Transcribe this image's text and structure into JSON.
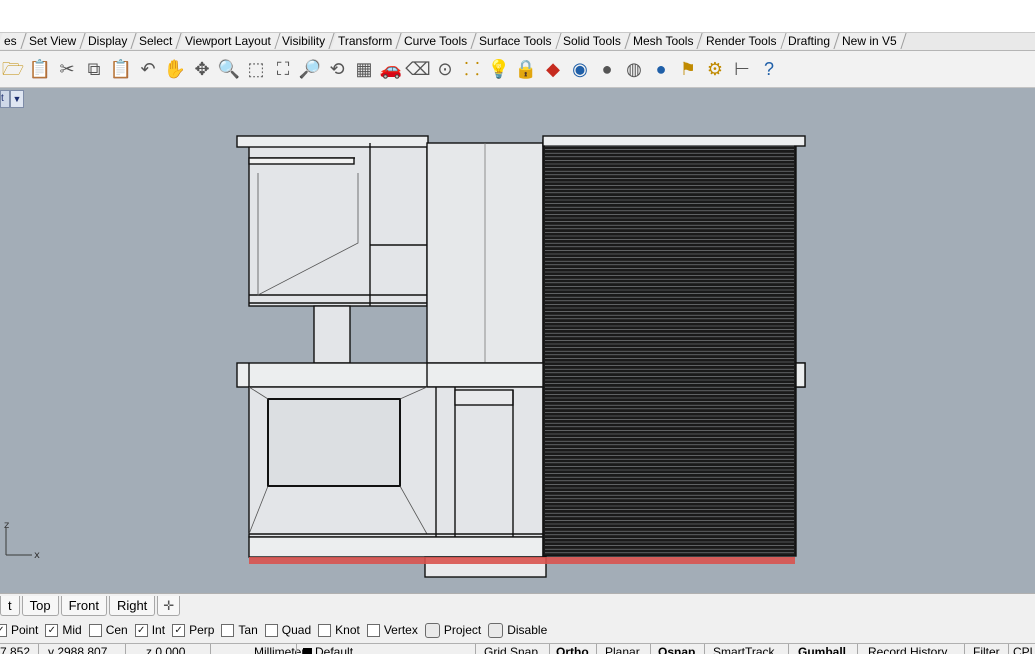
{
  "toolbar_tabs": [
    "es",
    "Set View",
    "Display",
    "Select",
    "Viewport Layout",
    "Visibility",
    "Transform",
    "Curve Tools",
    "Surface Tools",
    "Solid Tools",
    "Mesh Tools",
    "Render Tools",
    "Drafting",
    "New in V5"
  ],
  "toolbar_icons": [
    {
      "name": "open-icon",
      "glyph": "🗁",
      "cls": "c3"
    },
    {
      "name": "paste-icon",
      "glyph": "📋",
      "cls": "c5"
    },
    {
      "name": "cut-icon",
      "glyph": "✂",
      "cls": "c5"
    },
    {
      "name": "copy-icon",
      "glyph": "⧉",
      "cls": "c5"
    },
    {
      "name": "clipboard-icon",
      "glyph": "📋",
      "cls": "c3"
    },
    {
      "name": "undo-icon",
      "glyph": "↶",
      "cls": "c5"
    },
    {
      "name": "pan-hand-icon",
      "glyph": "✋",
      "cls": "c5"
    },
    {
      "name": "rotate-view-icon",
      "glyph": "✥",
      "cls": "c5"
    },
    {
      "name": "zoom-icon",
      "glyph": "🔍",
      "cls": "c5"
    },
    {
      "name": "zoom-window-icon",
      "glyph": "⬚",
      "cls": "c5"
    },
    {
      "name": "zoom-extents-icon",
      "glyph": "⛶",
      "cls": "c5"
    },
    {
      "name": "zoom-selected-icon",
      "glyph": "🔎",
      "cls": "c3"
    },
    {
      "name": "undo-view-icon",
      "glyph": "⟲",
      "cls": "c5"
    },
    {
      "name": "four-viewports-icon",
      "glyph": "▦",
      "cls": "c5"
    },
    {
      "name": "car-icon",
      "glyph": "🚗",
      "cls": "c2"
    },
    {
      "name": "eraser-icon",
      "glyph": "⌫",
      "cls": "c5"
    },
    {
      "name": "osnap-icon",
      "glyph": "⊙",
      "cls": "c5"
    },
    {
      "name": "point-edit-icon",
      "glyph": "⸬",
      "cls": "c3"
    },
    {
      "name": "light-bulb-icon",
      "glyph": "💡",
      "cls": "c5"
    },
    {
      "name": "lock-icon",
      "glyph": "🔒",
      "cls": "c5"
    },
    {
      "name": "layer-icon",
      "glyph": "◆",
      "cls": "c2"
    },
    {
      "name": "color-wheel-icon",
      "glyph": "◉",
      "cls": "c1"
    },
    {
      "name": "render-sphere-icon",
      "glyph": "●",
      "cls": "c5"
    },
    {
      "name": "shaded-sphere-icon",
      "glyph": "◍",
      "cls": "c5"
    },
    {
      "name": "blue-sphere-icon",
      "glyph": "●",
      "cls": "c1"
    },
    {
      "name": "flag-icon",
      "glyph": "⚑",
      "cls": "c3"
    },
    {
      "name": "options-gear-icon",
      "glyph": "⚙",
      "cls": "c3"
    },
    {
      "name": "dimension-icon",
      "glyph": "⊢",
      "cls": "c5"
    },
    {
      "name": "help-icon",
      "glyph": "?",
      "cls": "c1"
    }
  ],
  "viewport_tabs": [
    "t",
    "Top",
    "Front",
    "Right"
  ],
  "osnaps": [
    {
      "label": "Point",
      "checked": true
    },
    {
      "label": "Mid",
      "checked": true
    },
    {
      "label": "Cen",
      "checked": false
    },
    {
      "label": "Int",
      "checked": true
    },
    {
      "label": "Perp",
      "checked": true
    },
    {
      "label": "Tan",
      "checked": false
    },
    {
      "label": "Quad",
      "checked": false
    },
    {
      "label": "Knot",
      "checked": false
    },
    {
      "label": "Vertex",
      "checked": false
    }
  ],
  "osnap_buttons": [
    "Project",
    "Disable"
  ],
  "status": {
    "x": "7.852",
    "y": "y 2988.807",
    "z": "z 0.000",
    "units": "Millimeters",
    "layer": "Default",
    "panes": [
      "Grid Snap",
      "Ortho",
      "Planar",
      "Osnap",
      "SmartTrack",
      "Gumball",
      "Record History",
      "Filter",
      "CPU"
    ]
  },
  "axis": {
    "z": "z",
    "x": "x"
  },
  "colors": {
    "viewport_bg": "#a3adb7",
    "highlight": "#d9534f"
  }
}
